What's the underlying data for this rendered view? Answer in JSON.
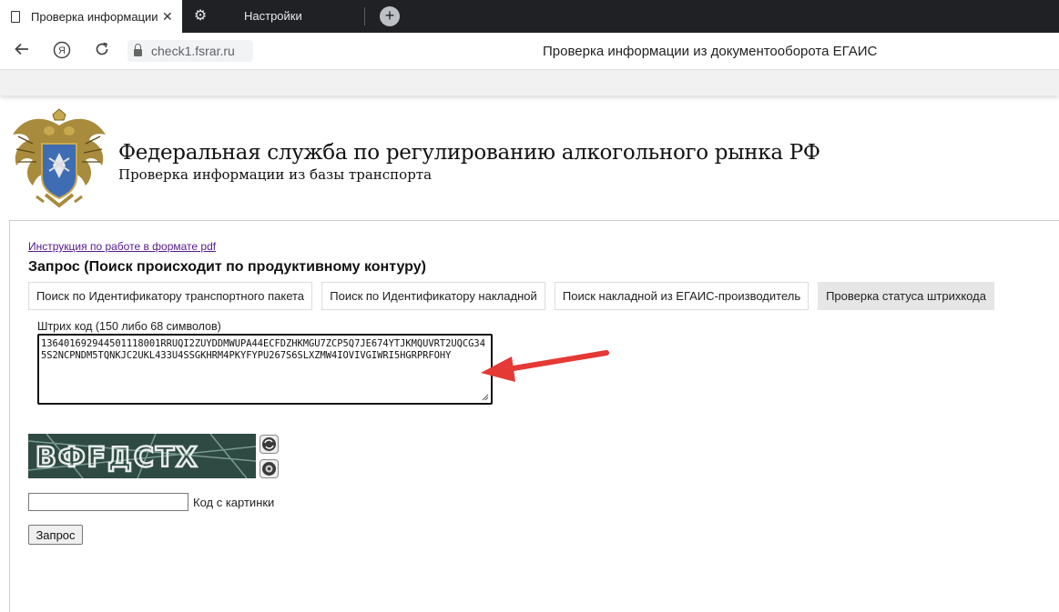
{
  "browser": {
    "active_tab_title": "Проверка информации из документооборота ЕГАИС",
    "settings_tab_title": "Настройки",
    "close_glyph": "✕",
    "new_tab_glyph": "+",
    "url": "check1.fsrar.ru",
    "page_title": "Проверка информации из документооборота ЕГАИС",
    "yandex_glyph": "Я"
  },
  "header": {
    "title": "Федеральная служба по регулированию алкогольного рынка РФ",
    "subtitle": "Проверка информации из базы транспорта"
  },
  "main": {
    "pdf_link": "Инструкция по работе в формате pdf",
    "query_heading": "Запрос (Поиск происходит по продуктивному контуру)",
    "modes": [
      {
        "label": "Поиск по Идентификатору транспортного пакета",
        "active": false
      },
      {
        "label": "Поиск по Идентификатору накладной",
        "active": false
      },
      {
        "label": "Поиск накладной из ЕГАИС-производитель",
        "active": false
      },
      {
        "label": "Проверка статуса штрихкода",
        "active": true
      }
    ],
    "barcode_label": "Штрих код (150 либо 68 символов)",
    "barcode_value": "136401692944501118001RRUQI2ZUYDDMWUPA44ECFDZHKMGU7ZCP5Q7JE674YTJKMQUVRT2UQCG345S2NCPNDM5TQNKJC2UKL433U4SSGKHRM4PKYFYPU267S6SLXZMW4IOVIVGIWRI5HGRPRFOHY",
    "captcha_text": "ВФFДСТХ",
    "code_label": "Код с картинки",
    "code_value": "",
    "submit_label": "Запрос"
  },
  "colors": {
    "tabstrip": "#202124",
    "captcha_bg": "#2e4a43",
    "arrow": "#e53935",
    "link": "#551a8b"
  },
  "icons": [
    "document-icon",
    "gear-icon",
    "back-arrow-icon",
    "yandex-icon",
    "reload-icon",
    "lock-icon",
    "refresh-icon",
    "audio-icon"
  ]
}
